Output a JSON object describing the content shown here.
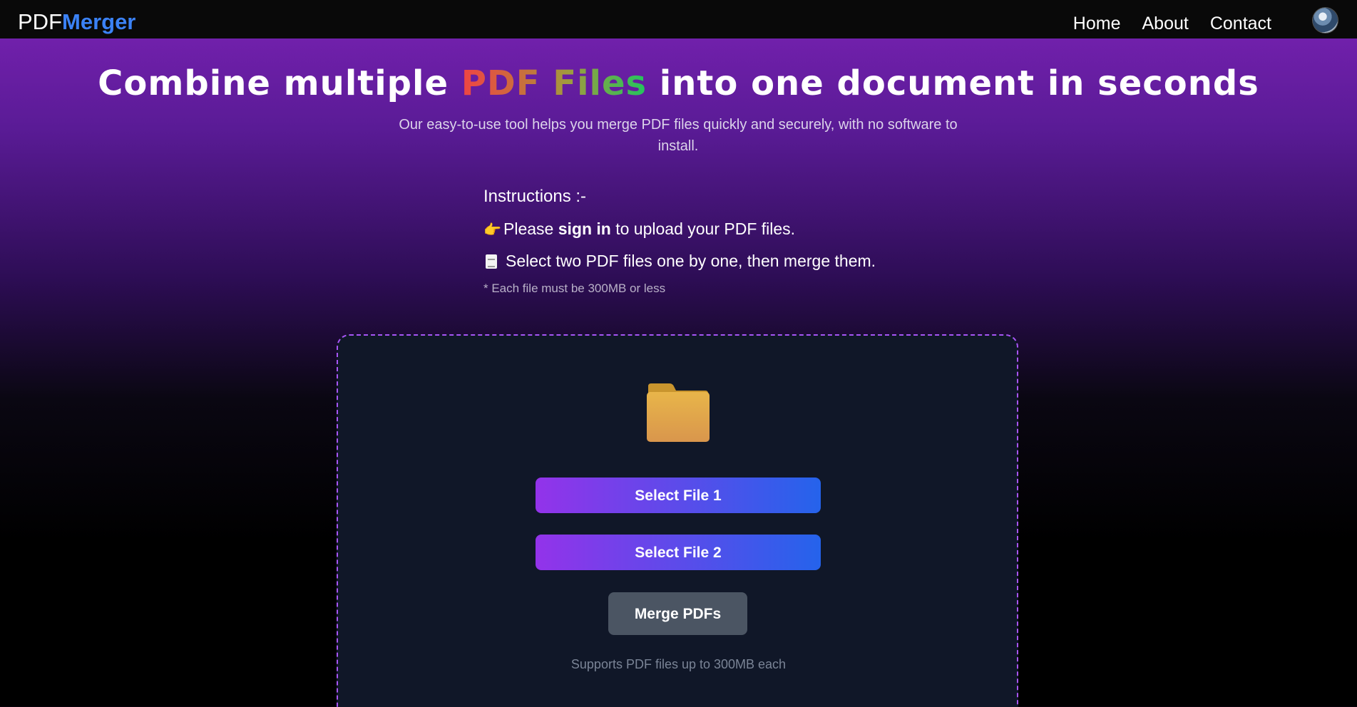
{
  "brand": {
    "part1": "PDF",
    "part2": "Merger"
  },
  "nav": {
    "links": [
      "Home",
      "About",
      "Contact"
    ]
  },
  "hero": {
    "title_before": "Combine multiple ",
    "title_accent": "PDF Files",
    "title_after": " into one document in seconds",
    "subtitle": "Our easy-to-use tool helps you merge PDF files quickly and securely, with no software to install."
  },
  "instructions": {
    "heading": "Instructions :-",
    "line1_prefix": "Please ",
    "line1_bold": "sign in",
    "line1_suffix": " to upload your PDF files.",
    "line2": "Select two PDF files one by one, then merge them.",
    "note": "* Each file must be 300MB or less",
    "icons": [
      "pointing-hand-icon",
      "document-icon"
    ]
  },
  "upload": {
    "folder_icon": "folder-icon",
    "select_file_1": "Select File 1",
    "select_file_2": "Select File 2",
    "merge": "Merge PDFs",
    "support_text": "Supports PDF files up to 300MB each"
  },
  "colors": {
    "brand_accent": "#3b82f6",
    "button_gradient_start": "#9333ea",
    "button_gradient_end": "#2563eb",
    "merge_button": "#4b5563",
    "dropzone_border": "#a855f7"
  }
}
